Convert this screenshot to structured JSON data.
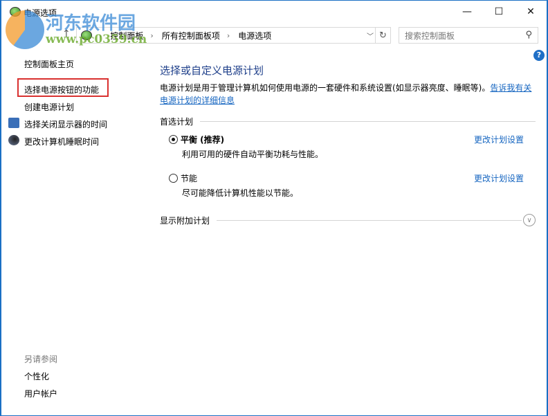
{
  "window": {
    "title": "电源选项",
    "minimize": "—",
    "maximize": "☐",
    "close": "✕"
  },
  "nav": {
    "back": "←",
    "forward": "→",
    "up": "↑",
    "breadcrumb": [
      "控制面板",
      "所有控制面板项",
      "电源选项"
    ],
    "search_placeholder": "搜索控制面板"
  },
  "sidebar": {
    "items": [
      {
        "label": "控制面板主页"
      },
      {
        "label": "选择电源按钮的功能"
      },
      {
        "label": "创建电源计划"
      },
      {
        "label": "选择关闭显示器的时间"
      },
      {
        "label": "更改计算机睡眠时间"
      }
    ],
    "see_also": "另请参阅",
    "see_also_items": [
      {
        "label": "个性化"
      },
      {
        "label": "用户帐户"
      }
    ]
  },
  "main": {
    "title": "选择或自定义电源计划",
    "description": "电源计划是用于管理计算机如何使用电源的一套硬件和系统设置(如显示器亮度、睡眠等)。",
    "learn_more": "告诉我有关电源计划的详细信息",
    "preferred_group": "首选计划",
    "plans": [
      {
        "name": "平衡 (推荐)",
        "desc": "利用可用的硬件自动平衡功耗与性能。",
        "selected": true,
        "link": "更改计划设置"
      },
      {
        "name": "节能",
        "desc": "尽可能降低计算机性能以节能。",
        "selected": false,
        "link": "更改计划设置"
      }
    ],
    "additional_group": "显示附加计划"
  },
  "watermark": {
    "name": "河东软件园",
    "url": "www.pc0359.cn"
  },
  "colors": {
    "accent": "#1565c0",
    "title": "#1e3f8a",
    "highlight": "#d9302f"
  }
}
